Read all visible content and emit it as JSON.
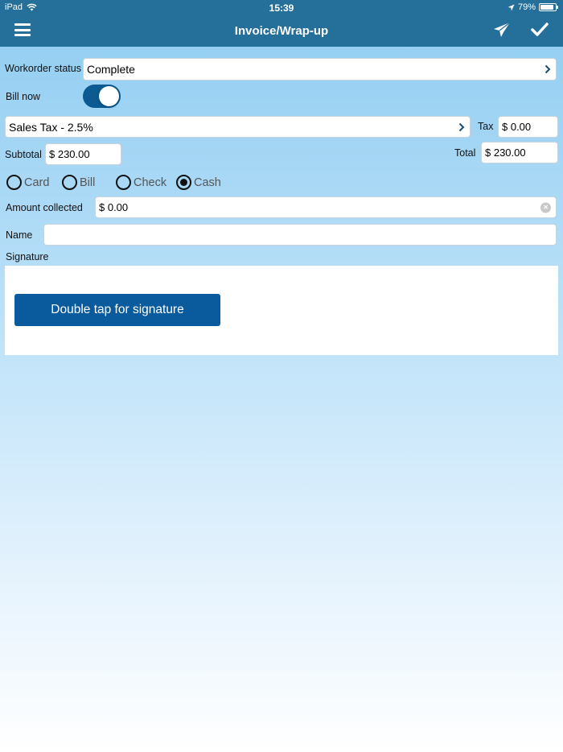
{
  "status_bar": {
    "device": "iPad",
    "time": "15:39",
    "battery": "79%",
    "battery_level": 0.79
  },
  "nav": {
    "title": "Invoice/Wrap-up"
  },
  "workorder": {
    "label": "Workorder status",
    "value": "Complete"
  },
  "bill_now": {
    "label": "Bill now",
    "on": true
  },
  "tax_rate": {
    "value": "Sales Tax - 2.5%"
  },
  "tax": {
    "label": "Tax",
    "value": "$ 0.00"
  },
  "subtotal": {
    "label": "Subtotal",
    "value": "$ 230.00"
  },
  "total": {
    "label": "Total",
    "value": "$ 230.00"
  },
  "payment_methods": {
    "options": [
      "Card",
      "Bill",
      "Check",
      "Cash"
    ],
    "selected": "Cash"
  },
  "amount_collected": {
    "label": "Amount collected",
    "value": "$ 0.00"
  },
  "name": {
    "label": "Name",
    "value": ""
  },
  "signature": {
    "label": "Signature",
    "button": "Double tap for signature"
  },
  "colors": {
    "navbar": "#256f9b",
    "accent": "#0a5b9d"
  }
}
